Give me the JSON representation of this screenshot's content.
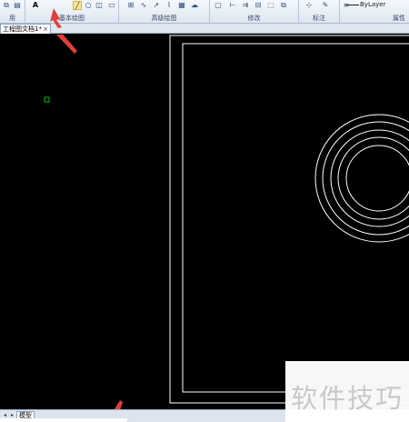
{
  "ribbon": {
    "text_tool": "A",
    "groups": {
      "g0": "用",
      "g1": "基本绘图",
      "g2": "高级绘图",
      "g3": "修改",
      "g4": "标注",
      "g5": "属性"
    },
    "linetype": "ByLayer"
  },
  "tabs": {
    "document": "工程图文档1*",
    "close": "×"
  },
  "bottom": {
    "model_tab": "模型"
  },
  "watermark": "软件技巧",
  "colors": {
    "canvas": "#000000",
    "drawing_lines": "#ffffff",
    "ucs_marker": "#00c000",
    "annotation_arrow": "#e0403a"
  }
}
